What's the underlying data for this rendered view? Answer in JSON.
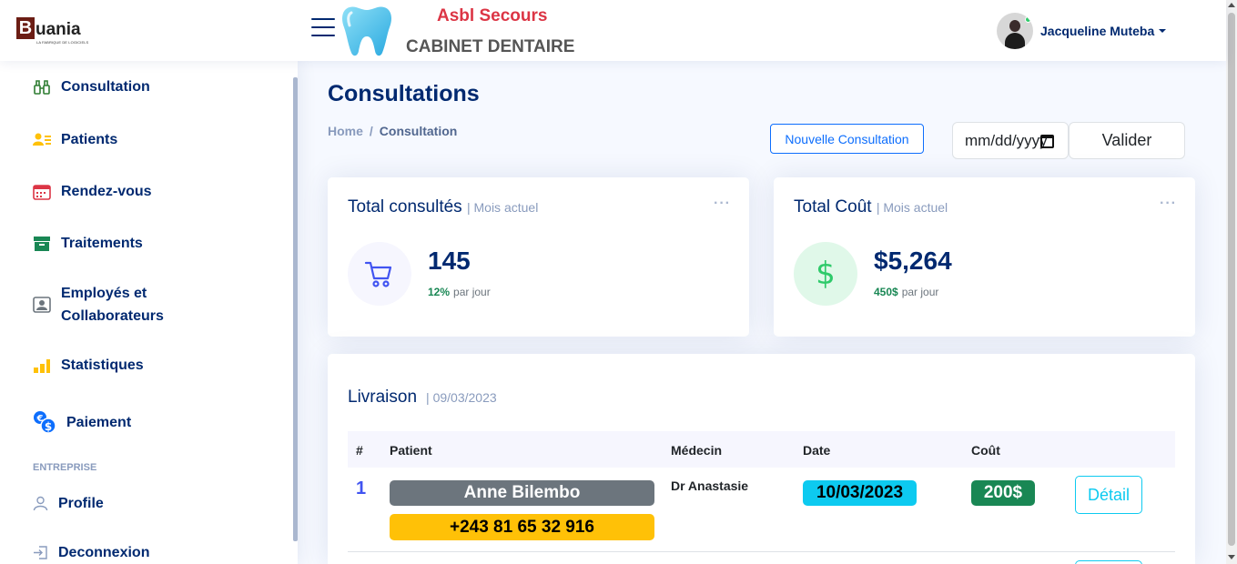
{
  "header": {
    "logo_letter": "B",
    "logo_rest": "uania",
    "logo_tagline": "LA FABRIQUE DE LOGICIELS",
    "org_name": "Asbl Secours",
    "clinic_name": "CABINET DENTAIRE",
    "user_name": "Jacqueline Muteba",
    "icons": [
      "hamburger-menu-icon",
      "tooth-icon",
      "chevron-down-icon"
    ]
  },
  "sidebar": {
    "items": [
      {
        "label": "Consultation",
        "icon": "binoculars-icon",
        "color": "#2e7d32"
      },
      {
        "label": "Patients",
        "icon": "person-lines-icon",
        "color": "#ffc107"
      },
      {
        "label": "Rendez-vous",
        "icon": "calendar-icon",
        "color": "#dc3545"
      },
      {
        "label": "Traitements",
        "icon": "box-icon",
        "color": "#198754"
      },
      {
        "label": "Employés et",
        "label2": "Collaborateurs",
        "icon": "person-badge-icon",
        "color": "#6c757d"
      },
      {
        "label": "Statistiques",
        "icon": "bar-chart-icon",
        "color": "#ffc107"
      },
      {
        "label": "Paiement",
        "icon": "currency-exchange-icon",
        "color": "#0d6efd"
      }
    ],
    "heading": "ENTREPRISE",
    "bottom_items": [
      {
        "label": "Profile",
        "icon": "person-icon"
      },
      {
        "label": "Deconnexion",
        "icon": "box-arrow-in-right-icon"
      }
    ]
  },
  "main": {
    "title": "Consultations",
    "breadcrumb": {
      "home": "Home",
      "separator": "/",
      "current": "Consultation"
    },
    "new_button": "Nouvelle Consultation",
    "date_placeholder": "mm/dd/yyyy",
    "validate_button": "Valider"
  },
  "cards": {
    "consults": {
      "title": "Total consultés",
      "sub": "| Mois actuel",
      "dots": "···",
      "value": "145",
      "pct": "12%",
      "pct_label": "par jour",
      "icon": "cart-icon",
      "accent": "#4154f1",
      "bg": "#f6f6fe"
    },
    "cost": {
      "title": "Total Coût",
      "sub": "| Mois actuel",
      "dots": "···",
      "value": "$5,264",
      "pct": "450$",
      "pct_label": "par jour",
      "icon": "dollar-icon",
      "icon_glyph": "$",
      "accent": "#2eca6a",
      "bg": "#e0f8e9"
    }
  },
  "table": {
    "title": "Livraison",
    "sub": "| 09/03/2023",
    "headers": [
      "#",
      "Patient",
      "Médecin",
      "Date",
      "Coût"
    ],
    "rows": [
      {
        "num": "1",
        "patient": "Anne Bilembo",
        "phone": "+243 81 65 32 916",
        "doctor": "Dr Anastasie",
        "date": "10/03/2023",
        "cost": "200$",
        "action": "Détail"
      }
    ]
  }
}
